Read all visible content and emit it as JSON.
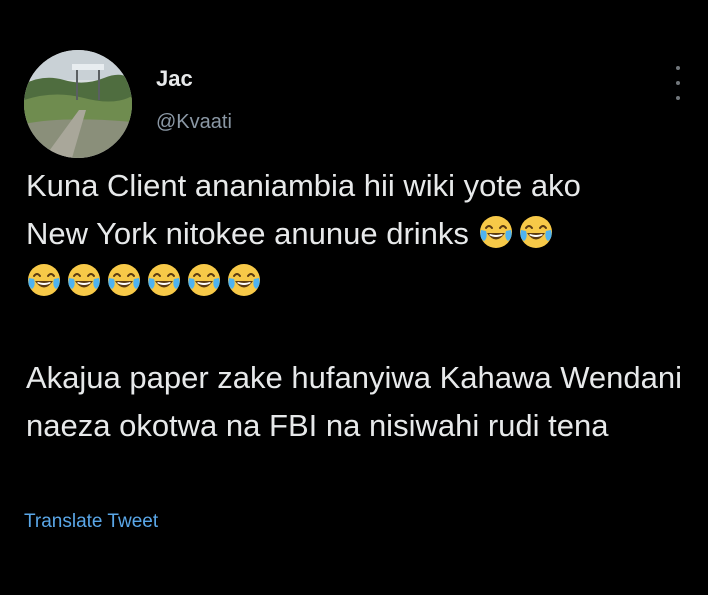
{
  "tweet": {
    "display_name": "Jac",
    "handle": "@Kvaati",
    "line1": "Kuna Client ananiambia hii wiki yote ako",
    "line2": "New York nitokee anunue drinks",
    "paragraph2": "Akajua paper zake hufanyiwa Kahawa Wendani naeza okotwa na FBI na nisiwahi rudi tena",
    "translate_label": "Translate Tweet",
    "emoji_name": "face-with-tears-of-joy-icon",
    "inline_emoji_count": 2,
    "row_emoji_count": 6
  },
  "colors": {
    "background": "#000000",
    "text": "#e7e9ea",
    "secondary_text": "#8b98a5",
    "link": "#5aa7e8"
  }
}
